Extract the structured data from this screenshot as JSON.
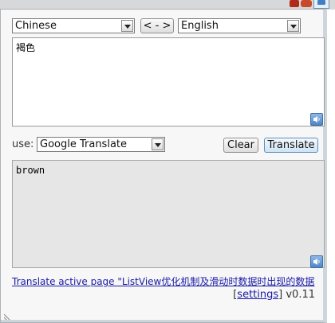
{
  "source_lang": {
    "selected": "Chinese"
  },
  "swap_label": "< - >",
  "target_lang": {
    "selected": "English"
  },
  "source_text": "褐色",
  "use_label": "use:",
  "engine": {
    "selected": "Google Translate"
  },
  "clear_label": "Clear",
  "translate_label": "Translate",
  "output_text": "brown",
  "translate_page_link": "Translate active page \"ListView优化机制及滑动时数据时出现的数据",
  "footer": {
    "open_bracket": "[",
    "settings_label": "settings",
    "close_bracket": "]",
    "version": " v0.11"
  },
  "colors": {
    "accent": "#4f86c6",
    "link": "#1a1aa6",
    "panel": "#f7f7f7"
  },
  "icons": {
    "speaker": "speaker-icon",
    "dropdown": "chevron-down-icon",
    "resize": "resize-grip-icon"
  }
}
